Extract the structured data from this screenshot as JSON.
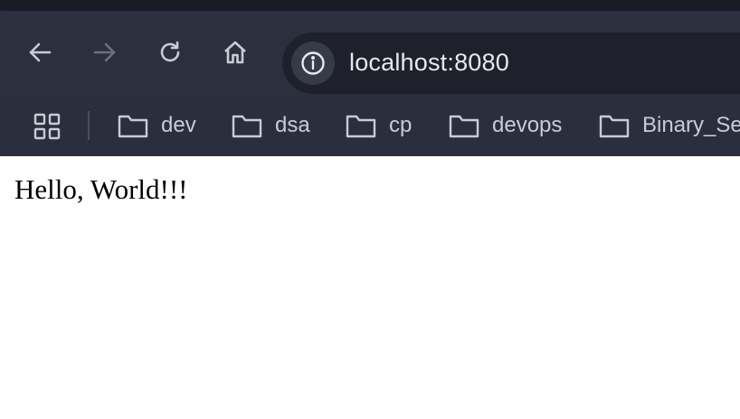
{
  "omnibox": {
    "url": "localhost:8080"
  },
  "bookmarks": [
    {
      "label": "dev"
    },
    {
      "label": "dsa"
    },
    {
      "label": "cp"
    },
    {
      "label": "devops"
    },
    {
      "label": "Binary_Se"
    }
  ],
  "page": {
    "body_text": "Hello, World!!!"
  },
  "colors": {
    "chrome_background": "#2c303e",
    "top_strip": "#181b24",
    "omnibox_background": "#1e212b",
    "icon_active": "#c8ccd6",
    "icon_disabled": "#6b7080",
    "page_background": "#ffffff"
  },
  "icons": {
    "back": "arrow-left-icon",
    "forward": "arrow-right-icon",
    "reload": "reload-icon",
    "home": "home-icon",
    "site_info": "info-icon",
    "apps": "apps-grid-icon",
    "bookmark_folder": "folder-icon"
  }
}
